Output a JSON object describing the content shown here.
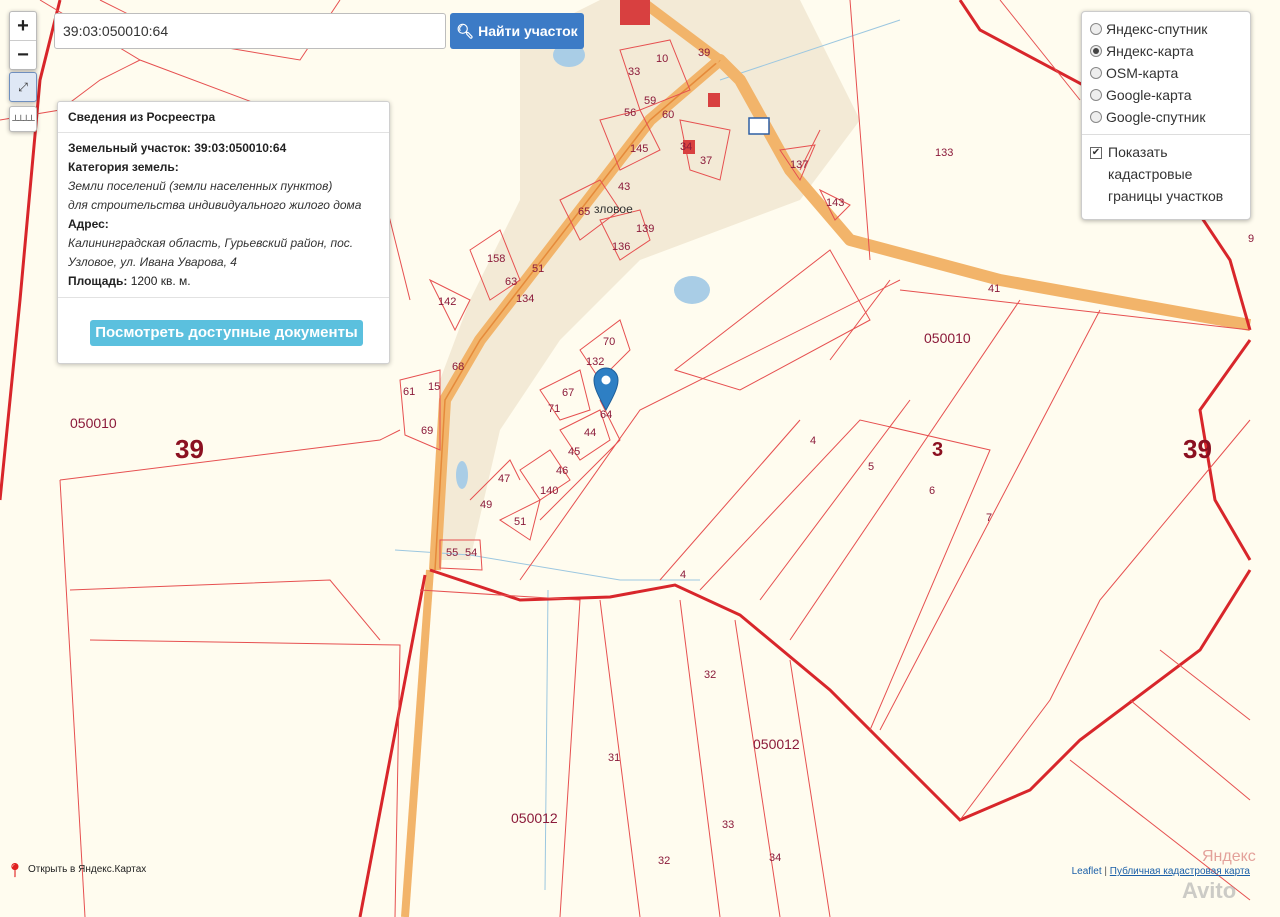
{
  "search": {
    "value": "39:03:050010:64",
    "button_label": "Найти участок"
  },
  "zoom": {
    "in_label": "+",
    "out_label": "−"
  },
  "info_panel": {
    "title": "Сведения из Росреестра",
    "parcel_label": "Земельный участок:",
    "parcel_value": "39:03:050010:64",
    "category_label": "Категория земель:",
    "category_value_1": "Земли поселений (земли населенных пунктов)",
    "category_value_2": "для строительства индивидуального жилого дома",
    "address_label": "Адрес:",
    "address_value_1": "Калининградская область, Гурьевский район, пос.",
    "address_value_2": "Узловое, ул. Ивана Уварова, 4",
    "area_label": "Площадь:",
    "area_value": "1200 кв. м.",
    "docs_button": "Посмотреть доступные документы"
  },
  "layers": {
    "options": [
      "Яндекс-спутник",
      "Яндекс-карта",
      "OSM-карта",
      "Google-карта",
      "Google-спутник"
    ],
    "selected": "Яндекс-карта",
    "checkbox_label": "Показать кадастровые границы участков",
    "checkbox_checked": true
  },
  "map_labels": {
    "region_left": "39",
    "region_right": "39",
    "region_mid": "3",
    "quarter_left": "050010",
    "quarter_right": "050010",
    "quarter_bottom_mid": "050012",
    "quarter_bottom_left": "050012",
    "road_39": "39",
    "road_41": "41",
    "road_43": "43",
    "village": "зловое",
    "num_133": "133",
    "num_9": "9",
    "parcels": [
      "33",
      "10",
      "59",
      "60",
      "56",
      "145",
      "34",
      "37",
      "137",
      "143",
      "65",
      "136",
      "139",
      "158",
      "63",
      "51",
      "134",
      "142",
      "70",
      "132",
      "67",
      "71",
      "64",
      "44",
      "45",
      "46",
      "140",
      "47",
      "49",
      "51",
      "55",
      "54",
      "68",
      "15",
      "61",
      "69",
      "4",
      "5",
      "6",
      "7",
      "4",
      "32",
      "31",
      "33",
      "32",
      "34"
    ]
  },
  "footer": {
    "open_yandex": "Открыть в Яндекс.Картах",
    "attrib_leaflet": "Leaflet",
    "attrib_sep": " | ",
    "attrib_pkk": "Публичная кадастровая карта",
    "yandex_wm": "Яндекс",
    "avito_wm": "Avito"
  },
  "colors": {
    "parcel_line": "#e03030",
    "road": "#f2b46a",
    "village_area": "#f3ead6",
    "water": "#a9cde6",
    "marker": "#2e7fc4"
  }
}
